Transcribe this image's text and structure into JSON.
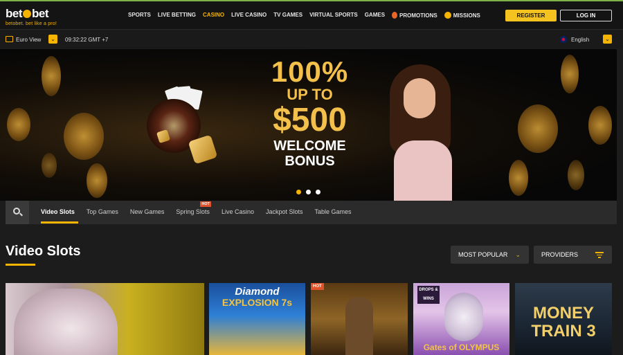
{
  "brand": {
    "name_left": "bet",
    "name_right": "bet",
    "tagline": "betobet. bet like a pro!"
  },
  "nav": [
    {
      "label": "SPORTS"
    },
    {
      "label": "LIVE BETTING"
    },
    {
      "label": "CASINO",
      "active": true
    },
    {
      "label": "LIVE CASINO"
    },
    {
      "label": "TV GAMES"
    },
    {
      "label": "VIRTUAL SPORTS"
    },
    {
      "label": "GAMES"
    },
    {
      "label": "PROMOTIONS",
      "icon": "fire-icon"
    },
    {
      "label": "MISSIONS",
      "icon": "missions-icon"
    }
  ],
  "auth": {
    "register": "REGISTER",
    "login": "LOG IN"
  },
  "subbar": {
    "view_label": "Euro View",
    "time": "09:32:22 GMT +7",
    "language": "English"
  },
  "banner": {
    "line1": "100%",
    "line2": "UP TO",
    "line3": "$500",
    "line4": "WELCOME",
    "line5": "BONUS",
    "active_slide": 1,
    "slide_count": 3
  },
  "categories": [
    {
      "label": "Video Slots",
      "active": true
    },
    {
      "label": "Top Games"
    },
    {
      "label": "New Games"
    },
    {
      "label": "Spring Slots",
      "badge": "HOT"
    },
    {
      "label": "Live Casino"
    },
    {
      "label": "Jackpot Slots"
    },
    {
      "label": "Table Games"
    }
  ],
  "section": {
    "title": "Video Slots"
  },
  "filters": {
    "sort": "MOST POPULAR",
    "providers": "PROVIDERS"
  },
  "games": [
    {
      "title": ""
    },
    {
      "title_a": "Diamond",
      "title_b": "EXPLOSION 7s"
    },
    {
      "badge": "HOT"
    },
    {
      "badge": "DROPS & WINS",
      "title": "Gates of OLYMPUS"
    },
    {
      "title_a": "MONEY",
      "title_b": "TRAIN 3"
    }
  ],
  "colors": {
    "accent": "#f4b400",
    "background": "#1c1c1c",
    "hot": "#e0522a"
  }
}
